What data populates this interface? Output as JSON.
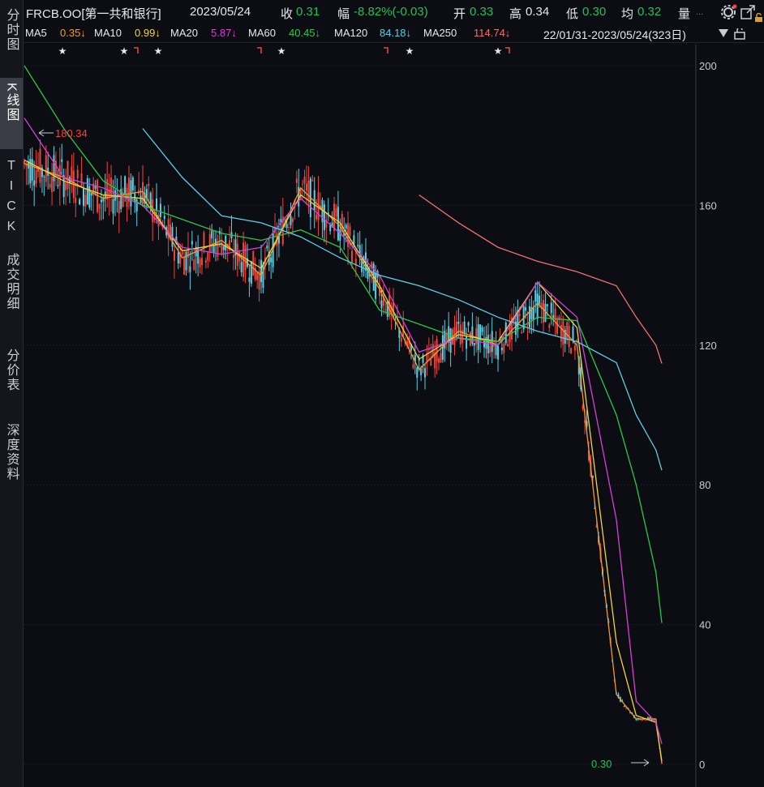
{
  "header": {
    "ticker": "FRCB.OO[第一共和银行]",
    "date": "2023/05/24",
    "close_label": "收",
    "close_value": "0.31",
    "change_label": "幅",
    "change_value": "-8.82%(-0.03)",
    "open_label": "开",
    "open_value": "0.33",
    "high_label": "高",
    "high_value": "0.34",
    "low_label": "低",
    "low_value": "0.30",
    "avg_label": "均",
    "avg_value": "0.32",
    "volume_label": "量",
    "volume_more": "...",
    "icons": [
      "gear-icon",
      "expand-icon",
      "lock-icon"
    ]
  },
  "ma": [
    {
      "label": "MA5",
      "value": "0.35↓",
      "color": "#f29a2e"
    },
    {
      "label": "MA10",
      "value": "0.99↓",
      "color": "#f3d43a"
    },
    {
      "label": "MA20",
      "value": "5.87↓",
      "color": "#d83fd8"
    },
    {
      "label": "MA60",
      "value": "40.45↓",
      "color": "#28c848"
    },
    {
      "label": "MA120",
      "value": "84.18↓",
      "color": "#5ad0e6"
    },
    {
      "label": "MA250",
      "value": "114.74↓",
      "color": "#f07070"
    }
  ],
  "range_label": "22/01/31-2023/05/24(323日)",
  "sidebar": [
    {
      "label": "分时图"
    },
    {
      "label": "K线图",
      "active": true
    },
    {
      "label": "TICK"
    },
    {
      "label": "成交明细"
    },
    {
      "label": "分价表"
    },
    {
      "label": "深度资料"
    }
  ],
  "annotations": {
    "high": "180.34",
    "low": "0.30"
  },
  "chart_data": {
    "type": "line",
    "y_ticks": [
      "200",
      "160",
      "120",
      "80",
      "40",
      "0"
    ],
    "ylim": [
      0,
      200
    ],
    "x": [
      0,
      20,
      40,
      60,
      80,
      100,
      120,
      140,
      160,
      180,
      200,
      220,
      240,
      260,
      280,
      300,
      310,
      320,
      323
    ],
    "series": [
      {
        "name": "MA5",
        "color": "#f29a2e",
        "values": [
          172,
          168,
          162,
          164,
          145,
          150,
          140,
          165,
          154,
          136,
          113,
          124,
          120,
          132,
          120,
          20,
          13,
          13,
          0.35
        ]
      },
      {
        "name": "MA10",
        "color": "#f3d43a",
        "values": [
          173,
          167,
          163,
          162,
          147,
          149,
          142,
          163,
          155,
          137,
          116,
          123,
          121,
          138,
          125,
          35,
          14,
          12,
          0.99
        ]
      },
      {
        "name": "MA20",
        "color": "#d83fd8",
        "values": [
          185,
          168,
          165,
          160,
          148,
          146,
          148,
          162,
          152,
          140,
          118,
          122,
          120,
          138,
          128,
          70,
          18,
          12,
          5.87
        ]
      },
      {
        "name": "MA60",
        "color": "#28c848",
        "values": [
          200,
          182,
          167,
          160,
          156,
          152,
          150,
          153,
          148,
          130,
          126,
          122,
          121,
          128,
          127,
          100,
          80,
          55,
          40.45
        ]
      },
      {
        "name": "MA120",
        "color": "#5ad0e6",
        "values": [
          null,
          null,
          null,
          182,
          168,
          157,
          155,
          151,
          145,
          140,
          137,
          133,
          128,
          124,
          121,
          115,
          100,
          90,
          84.18
        ]
      },
      {
        "name": "MA250",
        "color": "#f07070",
        "values": [
          null,
          null,
          null,
          null,
          null,
          null,
          null,
          null,
          null,
          null,
          163,
          155,
          148,
          144,
          141,
          137,
          128,
          120,
          114.74
        ]
      }
    ]
  }
}
